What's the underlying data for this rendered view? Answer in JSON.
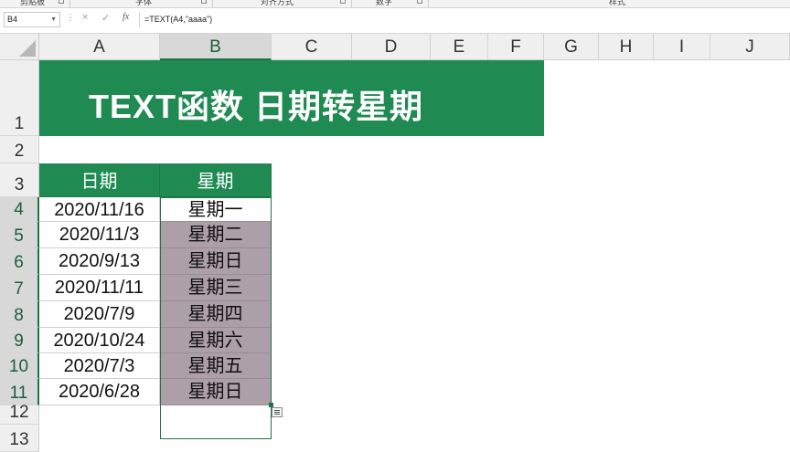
{
  "ribbon": {
    "groups": [
      "剪贴板",
      "字体",
      "对齐方式",
      "数字",
      "样式"
    ]
  },
  "formula_bar": {
    "name_box": "B4",
    "cancel_icon": "×",
    "enter_icon": "✓",
    "fx_label": "fx",
    "formula": "=TEXT(A4,\"aaaa\")"
  },
  "columns": [
    "A",
    "B",
    "C",
    "D",
    "E",
    "F",
    "G",
    "H",
    "I",
    "J"
  ],
  "rows": [
    "1",
    "2",
    "3",
    "4",
    "5",
    "6",
    "7",
    "8",
    "9",
    "10",
    "11",
    "12",
    "13"
  ],
  "sheet": {
    "title": "TEXT函数 日期转星期",
    "headers": {
      "date": "日期",
      "weekday": "星期"
    },
    "records": [
      {
        "date": "2020/11/16",
        "weekday": "星期一"
      },
      {
        "date": "2020/11/3",
        "weekday": "星期二"
      },
      {
        "date": "2020/9/13",
        "weekday": "星期日"
      },
      {
        "date": "2020/11/11",
        "weekday": "星期三"
      },
      {
        "date": "2020/7/9",
        "weekday": "星期四"
      },
      {
        "date": "2020/10/24",
        "weekday": "星期六"
      },
      {
        "date": "2020/7/3",
        "weekday": "星期五"
      },
      {
        "date": "2020/6/28",
        "weekday": "星期日"
      }
    ]
  },
  "colors": {
    "accent": "#1f8a52",
    "selection": "#217346",
    "selected_fill": "#ad9fa7"
  },
  "active_cell": "B4"
}
